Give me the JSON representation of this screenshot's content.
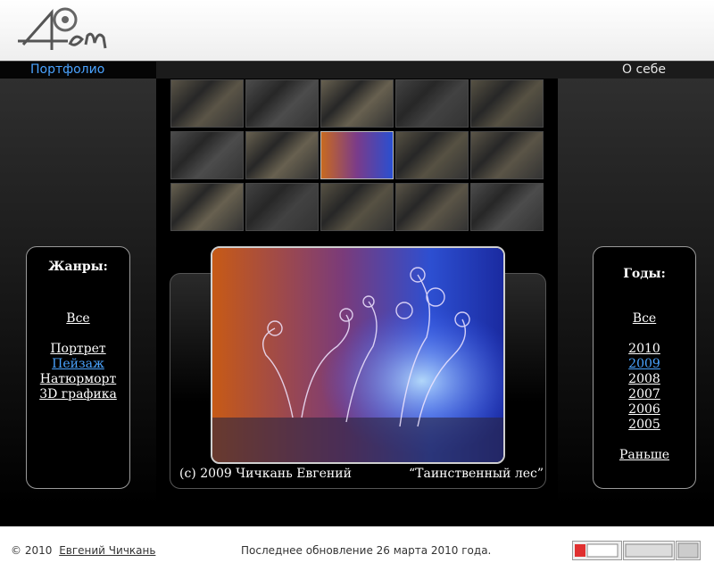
{
  "header": {
    "logo_alt": "4em"
  },
  "nav": {
    "portfolio_label": "Портфолио",
    "about_label": "О себе"
  },
  "genres": {
    "title": "Жанры:",
    "all": "Все",
    "items": [
      "Портрет",
      "Пейзаж",
      "Натюрморт",
      "3D графика"
    ],
    "active": "Пейзаж"
  },
  "years": {
    "title": "Годы:",
    "all": "Все",
    "items": [
      "2010",
      "2009",
      "2008",
      "2007",
      "2006",
      "2005"
    ],
    "active": "2009",
    "earlier": "Раньше"
  },
  "photo": {
    "author": "(c) 2009 Чичкань Евгений",
    "title": "“Таинственный лес”"
  },
  "thumbnails": {
    "rows": 3,
    "cols": 5,
    "selected_index": 7
  },
  "footer": {
    "copyright": "© 2010",
    "author": "Евгений Чичкань",
    "updated": "Последнее обновление 26 марта 2010 года."
  },
  "colors": {
    "accent": "#4aa3ff",
    "background": "#000000"
  }
}
